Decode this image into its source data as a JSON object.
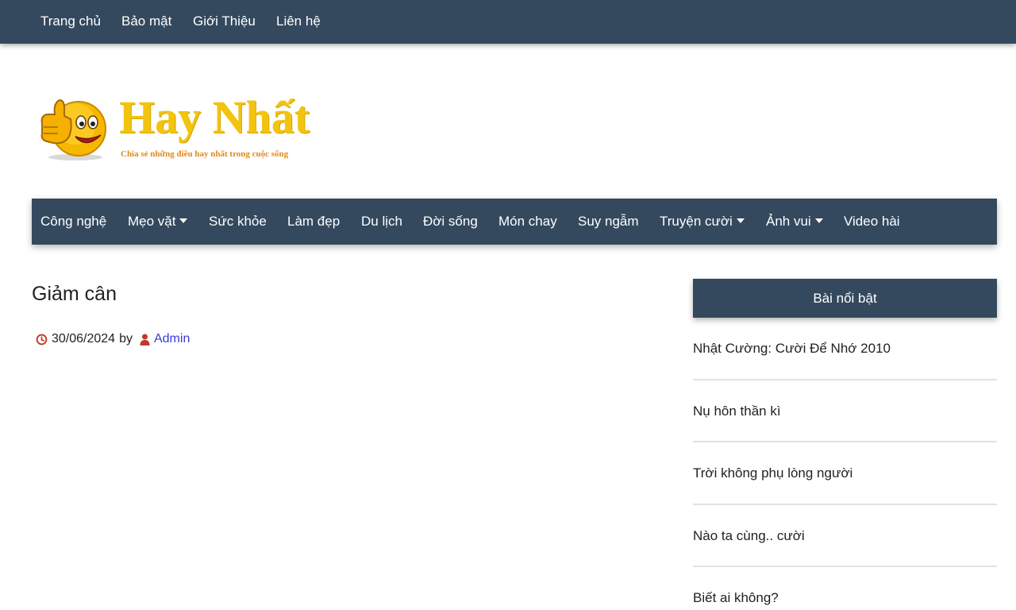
{
  "topnav": {
    "items": [
      {
        "label": "Trang chủ"
      },
      {
        "label": "Bảo mật"
      },
      {
        "label": "Giới Thiệu"
      },
      {
        "label": "Liên hệ"
      }
    ]
  },
  "logo": {
    "title": "Hay Nhất",
    "tagline": "Chia sẻ những điều hay nhất trong cuộc sống",
    "icon": "thumbs-up-smiley-icon"
  },
  "mainnav": {
    "items": [
      {
        "label": "Công nghệ",
        "dropdown": false
      },
      {
        "label": "Mẹo vặt",
        "dropdown": true
      },
      {
        "label": "Sức khỏe",
        "dropdown": false
      },
      {
        "label": "Làm đẹp",
        "dropdown": false
      },
      {
        "label": "Du lịch",
        "dropdown": false
      },
      {
        "label": "Đời sống",
        "dropdown": false
      },
      {
        "label": "Món chay",
        "dropdown": false
      },
      {
        "label": "Suy ngẫm",
        "dropdown": false
      },
      {
        "label": "Truyện cười",
        "dropdown": true
      },
      {
        "label": "Ảnh vui",
        "dropdown": true
      },
      {
        "label": "Video hài",
        "dropdown": false
      }
    ]
  },
  "post": {
    "title": "Giảm cân",
    "date": "30/06/2024",
    "by": "by",
    "author": "Admin",
    "date_icon": "clock-icon",
    "author_icon": "user-icon"
  },
  "sidebar": {
    "heading": "Bài nổi bật",
    "items": [
      {
        "label": "Nhật Cường: Cười Để Nhớ 2010"
      },
      {
        "label": "Nụ hôn thần kì"
      },
      {
        "label": "Trời không phụ lòng người"
      },
      {
        "label": "Nào ta cùng.. cười"
      },
      {
        "label": "Biết ai không?"
      }
    ]
  },
  "colors": {
    "nav_bg": "#34495e",
    "logo_yellow": "#f2c40f",
    "icon_red": "#c0392b",
    "link_blue": "#3b3bdc"
  }
}
